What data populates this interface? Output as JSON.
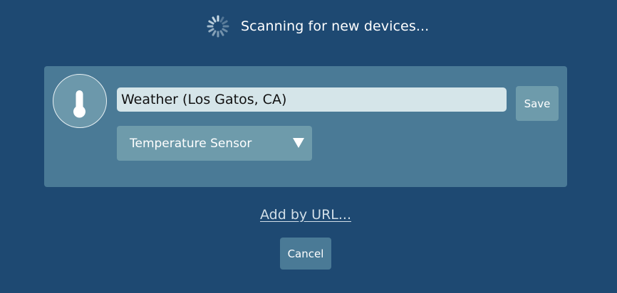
{
  "status": {
    "spinner_icon": "loading-spinner-icon",
    "text": "Scanning for new devices..."
  },
  "device": {
    "icon": "thermometer-icon",
    "name_value": "Weather (Los Gatos, CA)",
    "save_label": "Save",
    "type_selected": "Temperature Sensor",
    "dropdown_icon": "triangle-down-icon"
  },
  "actions": {
    "add_by_url_label": "Add by URL...",
    "cancel_label": "Cancel"
  },
  "colors": {
    "background": "#1e4972",
    "card": "#4a7a96",
    "control": "#6e9bab",
    "input": "#d5e5e9",
    "link": "#d2dfe8"
  }
}
